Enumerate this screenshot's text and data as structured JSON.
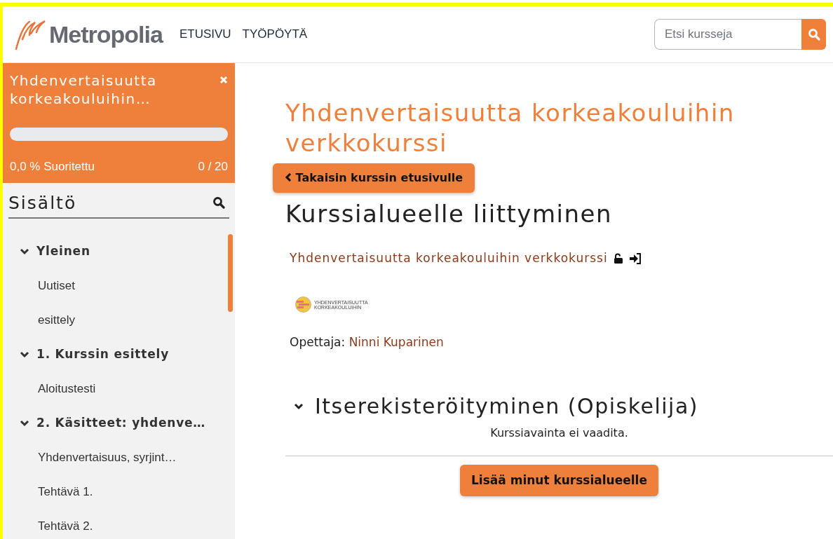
{
  "header": {
    "logo_text": "Metropolia",
    "nav": [
      {
        "label": "ETUSIVU"
      },
      {
        "label": "TYÖPÖYTÄ"
      }
    ],
    "search": {
      "placeholder": "Etsi kursseja"
    }
  },
  "sidebar": {
    "course_title": "Yhdenvertaisuutta korkeakouluihin…",
    "progress": {
      "level": 0,
      "percent_text": "0,0 % Suoritettu",
      "count_text": "0 / 20"
    },
    "contents_title": "Sisältö",
    "tree": [
      {
        "label": "Yleinen",
        "expanded": true,
        "children": [
          {
            "label": "Uutiset"
          },
          {
            "label": "esittely"
          }
        ]
      },
      {
        "label": "1. Kurssin esittely",
        "expanded": true,
        "children": [
          {
            "label": "Aloitustesti"
          }
        ]
      },
      {
        "label": "2. Käsitteet: yhdenve…",
        "expanded": true,
        "children": [
          {
            "label": "Yhdenvertaisuus, syrjint…"
          },
          {
            "label": "Tehtävä 1."
          },
          {
            "label": "Tehtävä 2."
          }
        ]
      }
    ]
  },
  "main": {
    "course_heading": "Yhdenvertaisuutta korkeakouluihin verkkokurssi",
    "back_button": "Takaisin kurssin etusivulle",
    "page_heading": "Kurssialueelle liittyminen",
    "course_link": "Yhdenvertaisuutta korkeakouluihin verkkokurssi",
    "course_logo_lines": [
      "YHDENVERTAISUUTTA",
      "KORKEAKOULUIHIN"
    ],
    "teacher_label": "Opettaja:",
    "teacher_name": "Ninni Kuparinen",
    "enrolment": {
      "title": "Itserekisteröityminen (Opiskelija)",
      "expanded": true,
      "note": "Kurssiavainta ei vaadita.",
      "button": "Lisää minut kurssialueelle"
    }
  }
}
